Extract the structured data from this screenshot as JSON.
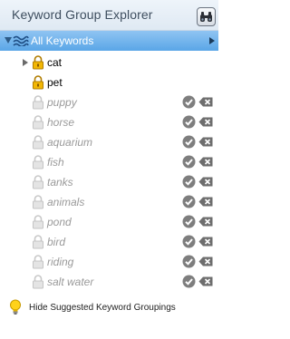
{
  "header": {
    "title": "Keyword Group Explorer",
    "search_icon": "binoculars-icon"
  },
  "root": {
    "label": "All Keywords",
    "icon": "waves-icon"
  },
  "groups": [
    {
      "label": "cat",
      "expandable": true
    },
    {
      "label": "pet",
      "expandable": false
    }
  ],
  "suggestions": [
    {
      "label": "puppy"
    },
    {
      "label": "horse"
    },
    {
      "label": "aquarium"
    },
    {
      "label": "fish"
    },
    {
      "label": "tanks"
    },
    {
      "label": "animals"
    },
    {
      "label": "pond"
    },
    {
      "label": "bird"
    },
    {
      "label": "riding"
    },
    {
      "label": "salt water"
    }
  ],
  "footer": {
    "label": "Hide Suggested Keyword Groupings",
    "icon": "lightbulb-icon"
  },
  "colors": {
    "header_bg": "#e6eef6",
    "selected_row": "#6db0ec",
    "lock_color": "#f0b400",
    "suggested_text": "#9a9a9a"
  }
}
